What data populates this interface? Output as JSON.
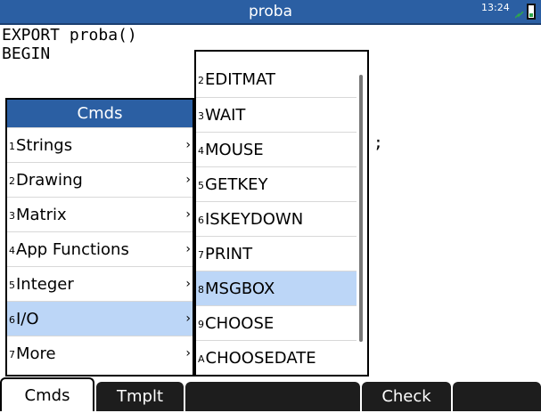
{
  "title": "proba",
  "status": {
    "time": "13:24"
  },
  "code": {
    "line1": "EXPORT proba()",
    "line2": "BEGIN",
    "fragment": ";"
  },
  "menu": {
    "header": "Cmds",
    "items": [
      {
        "num": "1",
        "label": "Strings",
        "arrow": "›"
      },
      {
        "num": "2",
        "label": "Drawing",
        "arrow": "›"
      },
      {
        "num": "3",
        "label": "Matrix",
        "arrow": "›"
      },
      {
        "num": "4",
        "label": "App Functions",
        "arrow": "›"
      },
      {
        "num": "5",
        "label": "Integer",
        "arrow": "›"
      },
      {
        "num": "6",
        "label": "I/O",
        "arrow": "›",
        "selected": true
      },
      {
        "num": "7",
        "label": "More",
        "arrow": "›"
      }
    ]
  },
  "submenu": {
    "items": [
      {
        "num": "2",
        "label": "EDITMAT"
      },
      {
        "num": "3",
        "label": "WAIT"
      },
      {
        "num": "4",
        "label": "MOUSE"
      },
      {
        "num": "5",
        "label": "GETKEY"
      },
      {
        "num": "6",
        "label": "ISKEYDOWN"
      },
      {
        "num": "7",
        "label": "PRINT"
      },
      {
        "num": "8",
        "label": "MSGBOX",
        "selected": true
      },
      {
        "num": "9",
        "label": "CHOOSE"
      },
      {
        "num": "A",
        "label": "CHOOSEDATE"
      }
    ]
  },
  "softkeys": [
    "Cmds",
    "Tmplt",
    "",
    "Check",
    ""
  ]
}
